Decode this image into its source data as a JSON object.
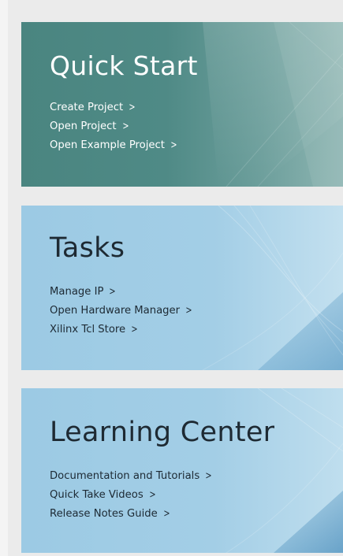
{
  "colors": {
    "quick_start_bg": "#4f8a86",
    "tasks_bg": "#9fcbe5",
    "learning_bg": "#9fcbe5",
    "light_text": "#ffffff",
    "dark_text": "#1e2a33",
    "page_bg": "#ebebeb"
  },
  "quick_start": {
    "title": "Quick Start",
    "links": [
      {
        "label": "Create Project",
        "chevron": ">"
      },
      {
        "label": "Open Project",
        "chevron": ">"
      },
      {
        "label": "Open Example Project",
        "chevron": ">"
      }
    ]
  },
  "tasks": {
    "title": "Tasks",
    "links": [
      {
        "label": "Manage IP",
        "chevron": ">"
      },
      {
        "label": "Open Hardware Manager",
        "chevron": ">"
      },
      {
        "label": "Xilinx Tcl Store",
        "chevron": ">"
      }
    ]
  },
  "learning_center": {
    "title": "Learning Center",
    "links": [
      {
        "label": "Documentation and Tutorials",
        "chevron": ">"
      },
      {
        "label": "Quick Take Videos",
        "chevron": ">"
      },
      {
        "label": "Release Notes Guide",
        "chevron": ">"
      }
    ]
  }
}
